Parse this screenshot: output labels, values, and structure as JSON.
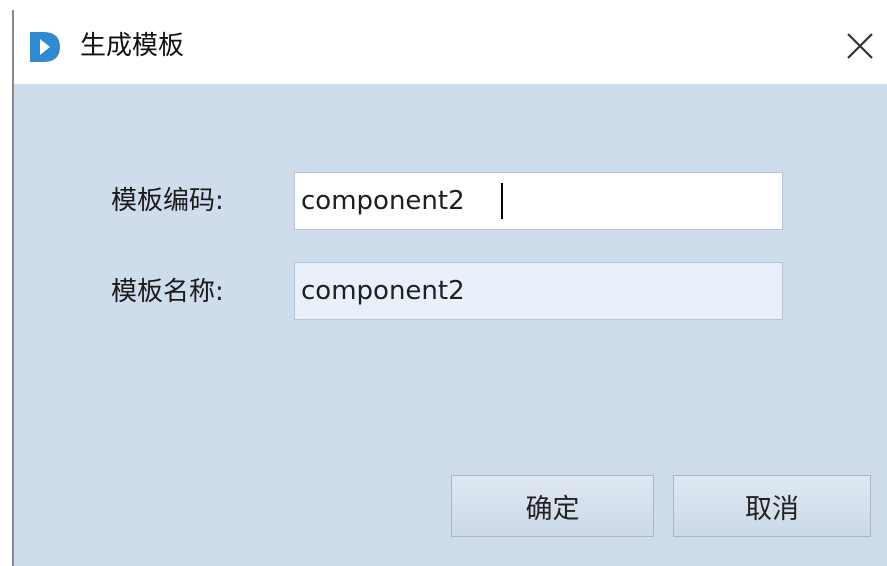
{
  "dialog": {
    "title": "生成模板",
    "icon": "app-logo-icon",
    "close_icon": "close-icon"
  },
  "form": {
    "code_label": "模板编码:",
    "code_value": "component2",
    "name_label": "模板名称:",
    "name_value": "component2"
  },
  "buttons": {
    "ok_label": "确定",
    "cancel_label": "取消"
  },
  "colors": {
    "dialog_background": "#cfdcec",
    "titlebar_background": "#ffffff",
    "icon_blue": "#2f8ad0"
  }
}
